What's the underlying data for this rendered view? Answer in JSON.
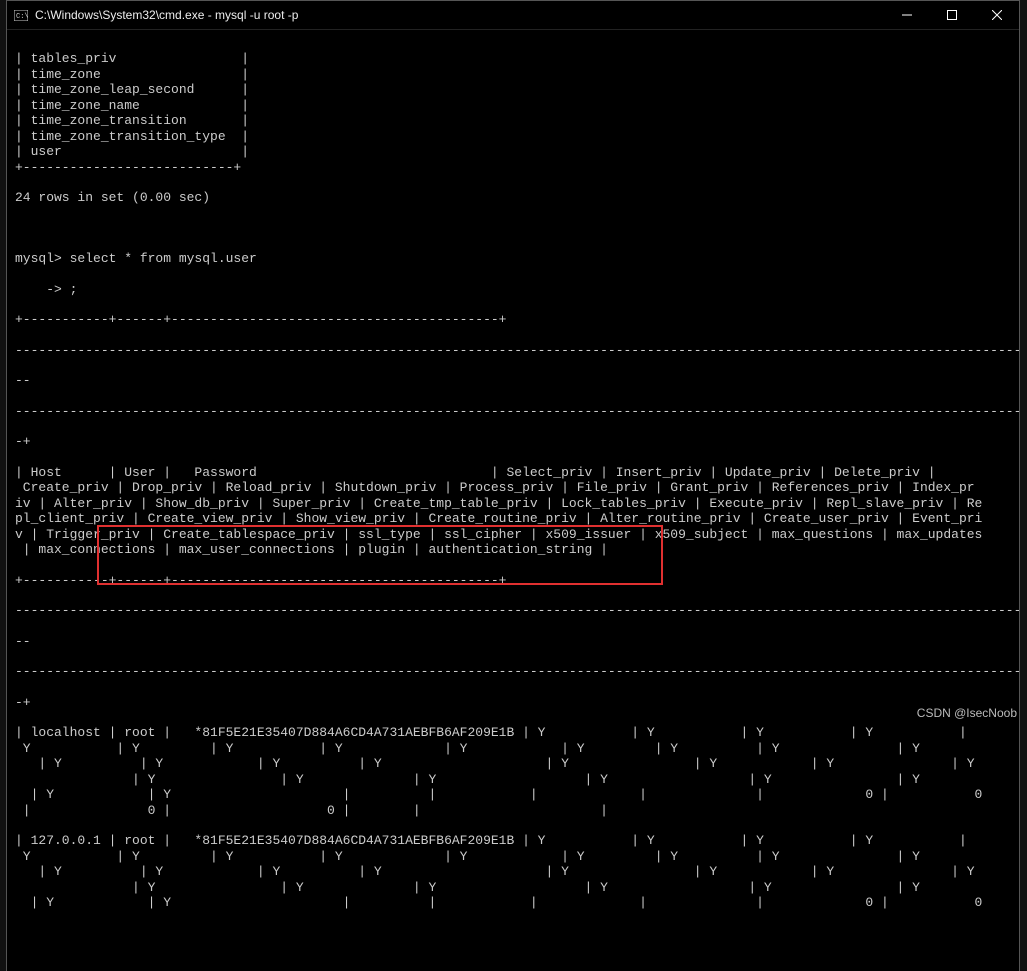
{
  "titlebar": {
    "title": "C:\\Windows\\System32\\cmd.exe - mysql  -u root -p"
  },
  "lines": {
    "table_frame": "| tables_priv                |\n| time_zone                  |\n| time_zone_leap_second      |\n| time_zone_name             |\n| time_zone_transition       |\n| time_zone_transition_type  |\n| user                       |\n+---------------------------+",
    "summary": "24 rows in set (0.00 sec)",
    "prompt1": "mysql> select * from mysql.user",
    "prompt2": "    -> ;",
    "header_sep": "+-----------+------+------------------------------------------+",
    "divline": "---------------------------------------------------------------------------------------------------------------------------------",
    "briv": "iv",
    "br_dash": "--",
    "br_plus": "-+",
    "col_header": "| Host      | User |   Password                              | Select_priv | Insert_priv | Update_priv | Delete_priv |\n Create_priv | Drop_priv | Reload_priv | Shutdown_priv | Process_priv | File_priv | Grant_priv | References_priv | Index_pr\niv | Alter_priv | Show_db_priv | Super_priv | Create_tmp_table_priv | Lock_tables_priv | Execute_priv | Repl_slave_priv | Re\npl_client_priv | Create_view_priv | Show_view_priv | Create_routine_priv | Alter_routine_priv | Create_user_priv | Event_pri\nv | Trigger_priv | Create_tablespace_priv | ssl_type | ssl_cipher | x509_issuer | x509_subject | max_questions | max_updates\n | max_connections | max_user_connections | plugin | authentication_string |",
    "row1": "| localhost | root |   *81F5E21E35407D884A6CD4A731AEBFB6AF209E1B | Y           | Y           | Y           | Y           |\n Y           | Y         | Y           | Y             | Y            | Y         | Y          | Y               | Y\n   | Y          | Y            | Y          | Y                     | Y                | Y            | Y               | Y\n               | Y                | Y              | Y                   | Y                  | Y                | Y\n  | Y            | Y                      |          |            |             |              |             0 |           0\n |               0 |                    0 |        |                       |",
    "row2": "| 127.0.0.1 | root |   *81F5E21E35407D884A6CD4A731AEBFB6AF209E1B | Y           | Y           | Y           | Y           |\n Y           | Y         | Y           | Y             | Y            | Y         | Y          | Y               | Y\n   | Y          | Y            | Y          | Y                     | Y                | Y            | Y               | Y\n               | Y                | Y              | Y                   | Y                  | Y                | Y\n  | Y            | Y                      |          |            |             |              |             0 |           0"
  },
  "watermark": "CSDN @IsecNoob"
}
